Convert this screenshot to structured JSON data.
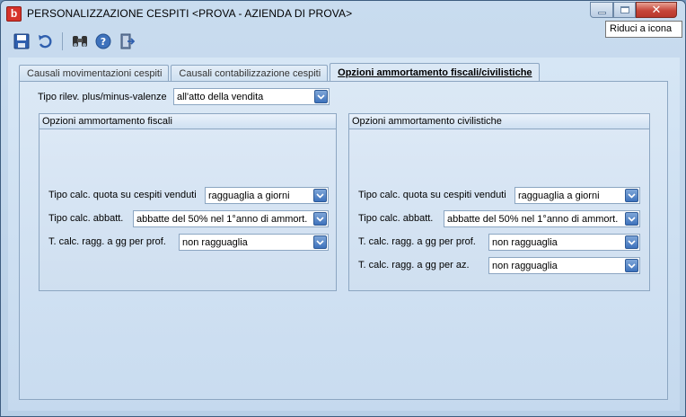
{
  "window": {
    "title": "PERSONALIZZAZIONE CESPITI <PROVA - AZIENDA DI PROVA>",
    "app_icon_letter": "b",
    "tooltip": "Riduci a icona"
  },
  "toolbar": {
    "icons": [
      "save-icon",
      "undo-icon",
      "find-icon",
      "help-icon",
      "exit-icon"
    ]
  },
  "tabs": [
    {
      "label": "Causali movimentazioni cespiti",
      "active": false
    },
    {
      "label": "Causali contabilizzazione cespiti",
      "active": false
    },
    {
      "label": "Opzioni ammortamento fiscali/civilistiche",
      "active": true
    }
  ],
  "plus_minus": {
    "label": "Tipo rilev. plus/minus-valenze",
    "value": "all'atto della vendita"
  },
  "fiscali": {
    "title": "Opzioni ammortamento fiscali",
    "rows": [
      {
        "label": "Tipo calc. quota su cespiti venduti",
        "value": "ragguaglia a giorni"
      },
      {
        "label": "Tipo calc. abbatt.",
        "value": "abbatte del 50% nel 1°anno di ammort."
      },
      {
        "label": "T. calc. ragg. a gg per prof.",
        "value": "non ragguaglia"
      }
    ]
  },
  "civilistiche": {
    "title": "Opzioni ammortamento civilistiche",
    "rows": [
      {
        "label": "Tipo calc. quota su cespiti venduti",
        "value": "ragguaglia a giorni"
      },
      {
        "label": "Tipo calc. abbatt.",
        "value": "abbatte del 50% nel 1°anno di ammort."
      },
      {
        "label": "T. calc. ragg. a gg per prof.",
        "value": "non ragguaglia"
      },
      {
        "label": "T. calc. ragg. a gg per az.",
        "value": "non ragguaglia"
      }
    ]
  },
  "colors": {
    "accent": "#3e72bc",
    "close_button": "#c6463a",
    "app_icon": "#d6332b"
  }
}
